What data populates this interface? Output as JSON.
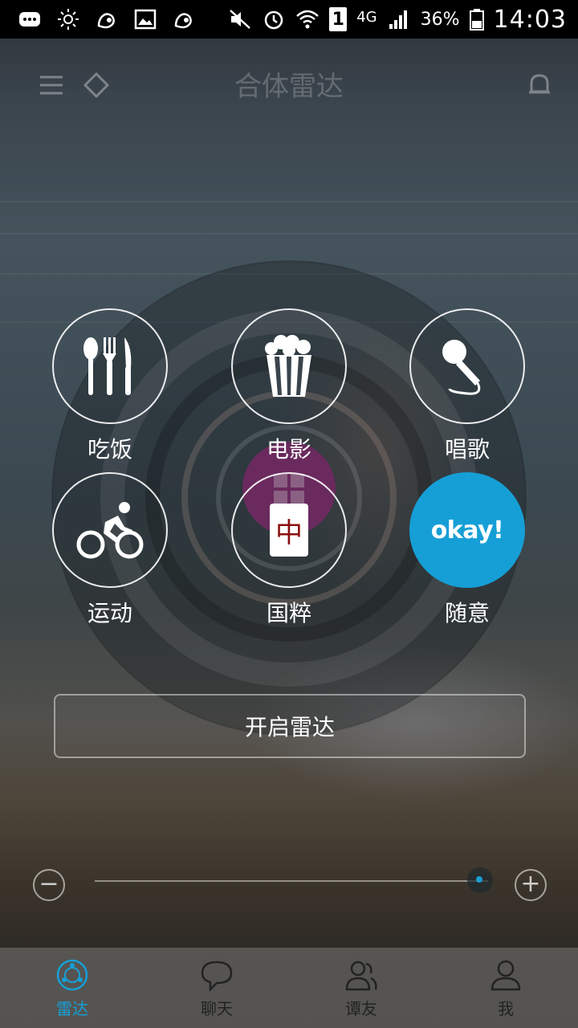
{
  "status_bar": {
    "network": "4G",
    "sim": "1",
    "battery": "36%",
    "time": "14:03"
  },
  "header": {
    "title": "合体雷达"
  },
  "activities": [
    {
      "label": "吃饭",
      "icon": "utensils-icon"
    },
    {
      "label": "电影",
      "icon": "popcorn-icon"
    },
    {
      "label": "唱歌",
      "icon": "microphone-icon"
    },
    {
      "label": "运动",
      "icon": "bicycle-icon"
    },
    {
      "label": "国粹",
      "icon": "mahjong-tile-icon",
      "tile_char": "中"
    },
    {
      "label": "随意",
      "icon": "okay-icon",
      "badge_text": "okay!"
    }
  ],
  "start_button": {
    "label": "开启雷达"
  },
  "range_slider": {
    "minus": "−",
    "plus": "+",
    "value": 0.98
  },
  "tabs": [
    {
      "label": "雷达",
      "active": true,
      "icon": "radar-icon"
    },
    {
      "label": "聊天",
      "active": false,
      "icon": "chat-bubble-icon"
    },
    {
      "label": "谭友",
      "active": false,
      "icon": "friends-icon"
    },
    {
      "label": "我",
      "active": false,
      "icon": "person-icon"
    }
  ],
  "colors": {
    "accent": "#169fd6",
    "radar_center": "#6a2a5e"
  }
}
